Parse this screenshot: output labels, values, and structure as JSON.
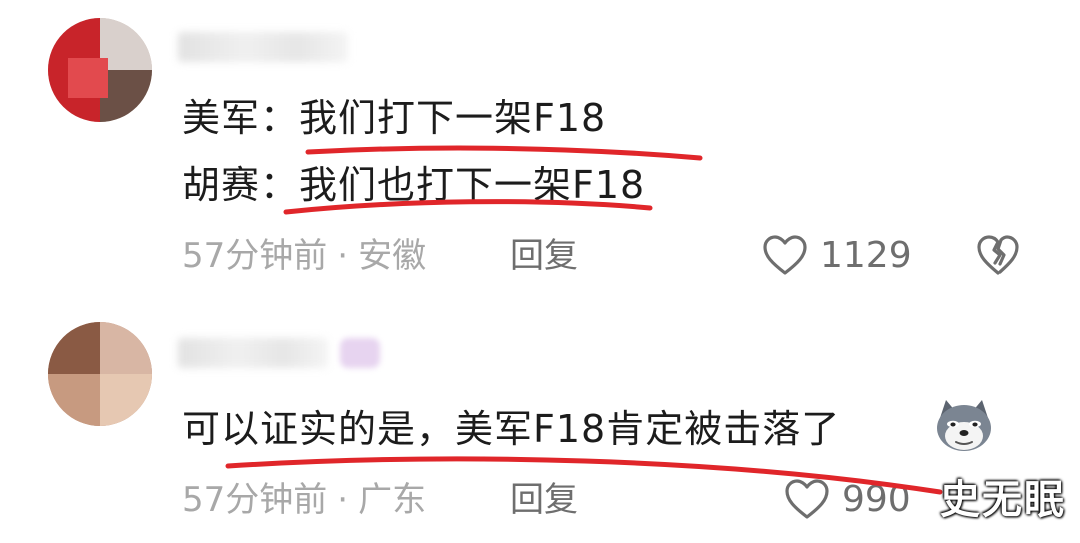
{
  "comments": [
    {
      "lines": [
        "美军：我们打下一架F18",
        "胡赛：我们也打下一架F18"
      ],
      "time": "57分钟前",
      "separator": "·",
      "location": "安徽",
      "reply_label": "回复",
      "like_count": "1129"
    },
    {
      "lines": [
        "可以证实的是，美军F18肯定被击落了"
      ],
      "time": "57分钟前",
      "separator": "·",
      "location": "广东",
      "reply_label": "回复",
      "like_count": "990"
    }
  ],
  "watermark": "史无眠",
  "colors": {
    "text": "#1c1c1c",
    "meta": "#a8a8a8",
    "underline": "#e0262a"
  },
  "icons": [
    "heart-outline-icon",
    "broken-heart-icon",
    "dog-emoji-icon"
  ]
}
